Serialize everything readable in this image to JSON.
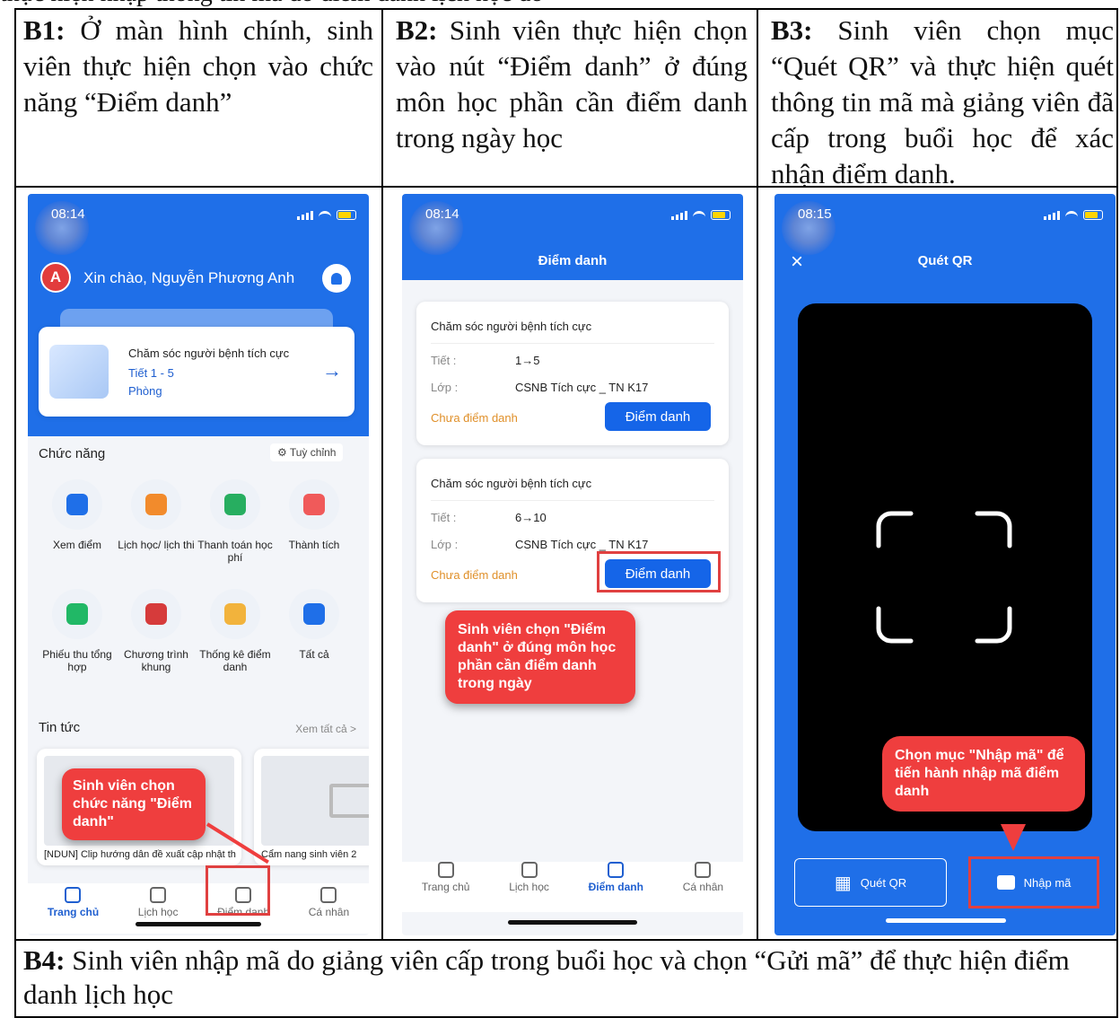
{
  "top_cut_text": "thực hiện nhập thông tin mã do điểm danh lịch học đó",
  "steps": [
    {
      "label": "B1:",
      "text": " Ở màn hình chính, sinh viên thực hiện chọn vào chức năng “Điểm danh”"
    },
    {
      "label": "B2:",
      "text": " Sinh viên thực hiện chọn vào nút “Điểm danh” ở đúng môn học phần cần điểm danh trong ngày học"
    },
    {
      "label": "B3:",
      "text": " Sinh viên chọn mục “Quét QR” và thực hiện quét thông tin mã mà giảng viên đã cấp trong buổi học để xác nhận điểm danh."
    },
    {
      "label": "B4:",
      "text": " Sinh viên nhập mã do giảng viên cấp trong buổi học và chọn “Gửi mã” để thực hiện điểm danh lịch học"
    }
  ],
  "colors": {
    "primary": "#1f6fe8",
    "callout": "#ef3e3e",
    "warning_text": "#e0902a"
  },
  "screen1": {
    "time": "08:14",
    "avatar": "A",
    "greeting": "Xin chào, Nguyễn Phương Anh",
    "schedule": {
      "course": "Chăm sóc người bệnh tích cực",
      "period": "Tiết 1 - 5",
      "room": "Phòng"
    },
    "section_title": "Chức năng",
    "customize": "Tuỳ chỉnh",
    "functions": [
      {
        "label": "Xem điểm",
        "icon": "grade-icon"
      },
      {
        "label": "Lịch học/ lịch thi",
        "icon": "calendar-icon"
      },
      {
        "label": "Thanh toán học phí",
        "icon": "coins-icon"
      },
      {
        "label": "Thành tích",
        "icon": "star-icon"
      },
      {
        "label": "Phiếu thu tổng hợp",
        "icon": "receipt-icon"
      },
      {
        "label": "Chương trình khung",
        "icon": "book-icon"
      },
      {
        "label": "Thống kê điểm danh",
        "icon": "user-check-icon"
      },
      {
        "label": "Tất cả",
        "icon": "grid-icon"
      }
    ],
    "news_title": "Tin tức",
    "news_all": "Xem tất cả >",
    "news": [
      "[NDUN] Clip hướng dẫn đề xuất cập nhật thông tin sinh viên",
      "Cẩm nang sinh viên 2"
    ],
    "tabs": [
      "Trang chủ",
      "Lịch học",
      "Điểm danh",
      "Cá nhân"
    ],
    "callout": "Sinh viên chọn chức năng \"Điểm danh\""
  },
  "screen2": {
    "time": "08:14",
    "title": "Điểm danh",
    "cards": [
      {
        "course": "Chăm sóc người bệnh tích cực",
        "period_label": "Tiết :",
        "period": "1→5",
        "class_label": "Lớp :",
        "class": "CSNB Tích cực _ TN K17",
        "status": "Chưa điểm danh",
        "button": "Điểm danh"
      },
      {
        "course": "Chăm sóc người bệnh tích cực",
        "period_label": "Tiết :",
        "period": "6→10",
        "class_label": "Lớp :",
        "class": "CSNB Tích cực _ TN K17",
        "status": "Chưa điểm danh",
        "button": "Điểm danh"
      }
    ],
    "callout": "Sinh viên chọn \"Điểm danh\" ở đúng môn học phần cần điểm danh trong ngày",
    "tabs": [
      "Trang chủ",
      "Lịch học",
      "Điểm danh",
      "Cá nhân"
    ]
  },
  "screen3": {
    "time": "08:15",
    "title": "Quét QR",
    "callout": "Chọn mục \"Nhập mã\" để tiến hành nhập mã điểm danh",
    "btn_scan": "Quét QR",
    "btn_input": "Nhập mã"
  }
}
